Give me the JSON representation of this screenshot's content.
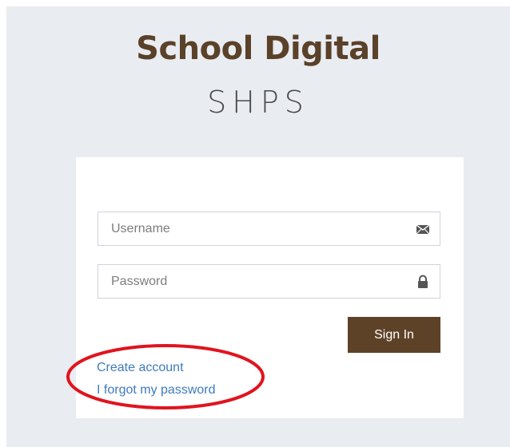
{
  "brand": {
    "title": "School Digital",
    "subtitle": "SHPS"
  },
  "login": {
    "username_placeholder": "Username",
    "username_icon": "envelope-icon",
    "password_placeholder": "Password",
    "password_icon": "lock-icon",
    "signin_label": "Sign In",
    "create_account_label": "Create account",
    "forgot_password_label": "I forgot my password"
  },
  "colors": {
    "page_background": "#e9ecf1",
    "brand_title": "#5a4129",
    "signin_button": "#5e4228",
    "link": "#3e7bbd",
    "annotation": "#e0141e"
  }
}
